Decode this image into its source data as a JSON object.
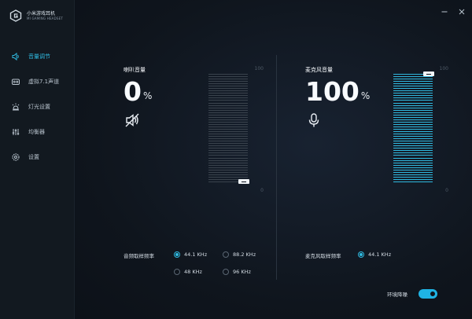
{
  "app": {
    "name": "小米游戏耳机",
    "subtitle": "MI GAMING HEADSET"
  },
  "window": {
    "minimize": "–",
    "close": "×"
  },
  "sidebar": {
    "items": [
      {
        "label": "音量调节",
        "icon": "speaker-icon",
        "active": true
      },
      {
        "label": "虚拟7.1声道",
        "icon": "surround-icon",
        "active": false
      },
      {
        "label": "灯光设置",
        "icon": "light-icon",
        "active": false
      },
      {
        "label": "均衡器",
        "icon": "equalizer-icon",
        "active": false
      },
      {
        "label": "设置",
        "icon": "gear-icon",
        "active": false
      }
    ]
  },
  "speaker": {
    "title": "喇叭音量",
    "value": "0",
    "unit": "%",
    "level": 0,
    "meter_max": "100",
    "meter_min": "0",
    "icon": "speaker-muted-icon"
  },
  "mic": {
    "title": "麦克风音量",
    "value": "100",
    "unit": "%",
    "level": 100,
    "meter_max": "100",
    "meter_min": "0",
    "icon": "microphone-icon"
  },
  "audio_rate": {
    "label": "音频取样频率",
    "options": [
      {
        "label": "44.1 KHz",
        "selected": true
      },
      {
        "label": "88.2 KHz",
        "selected": false
      },
      {
        "label": "48 KHz",
        "selected": false
      },
      {
        "label": "96 KHz",
        "selected": false
      }
    ]
  },
  "mic_rate": {
    "label": "麦克风取样频率",
    "options": [
      {
        "label": "44.1 KHz",
        "selected": true
      }
    ]
  },
  "ambient": {
    "label": "环境降噪",
    "enabled": true
  },
  "colors": {
    "accent": "#2fb9df",
    "meter_inactive": "#3a434d",
    "meter_active": "#2fb9df"
  }
}
